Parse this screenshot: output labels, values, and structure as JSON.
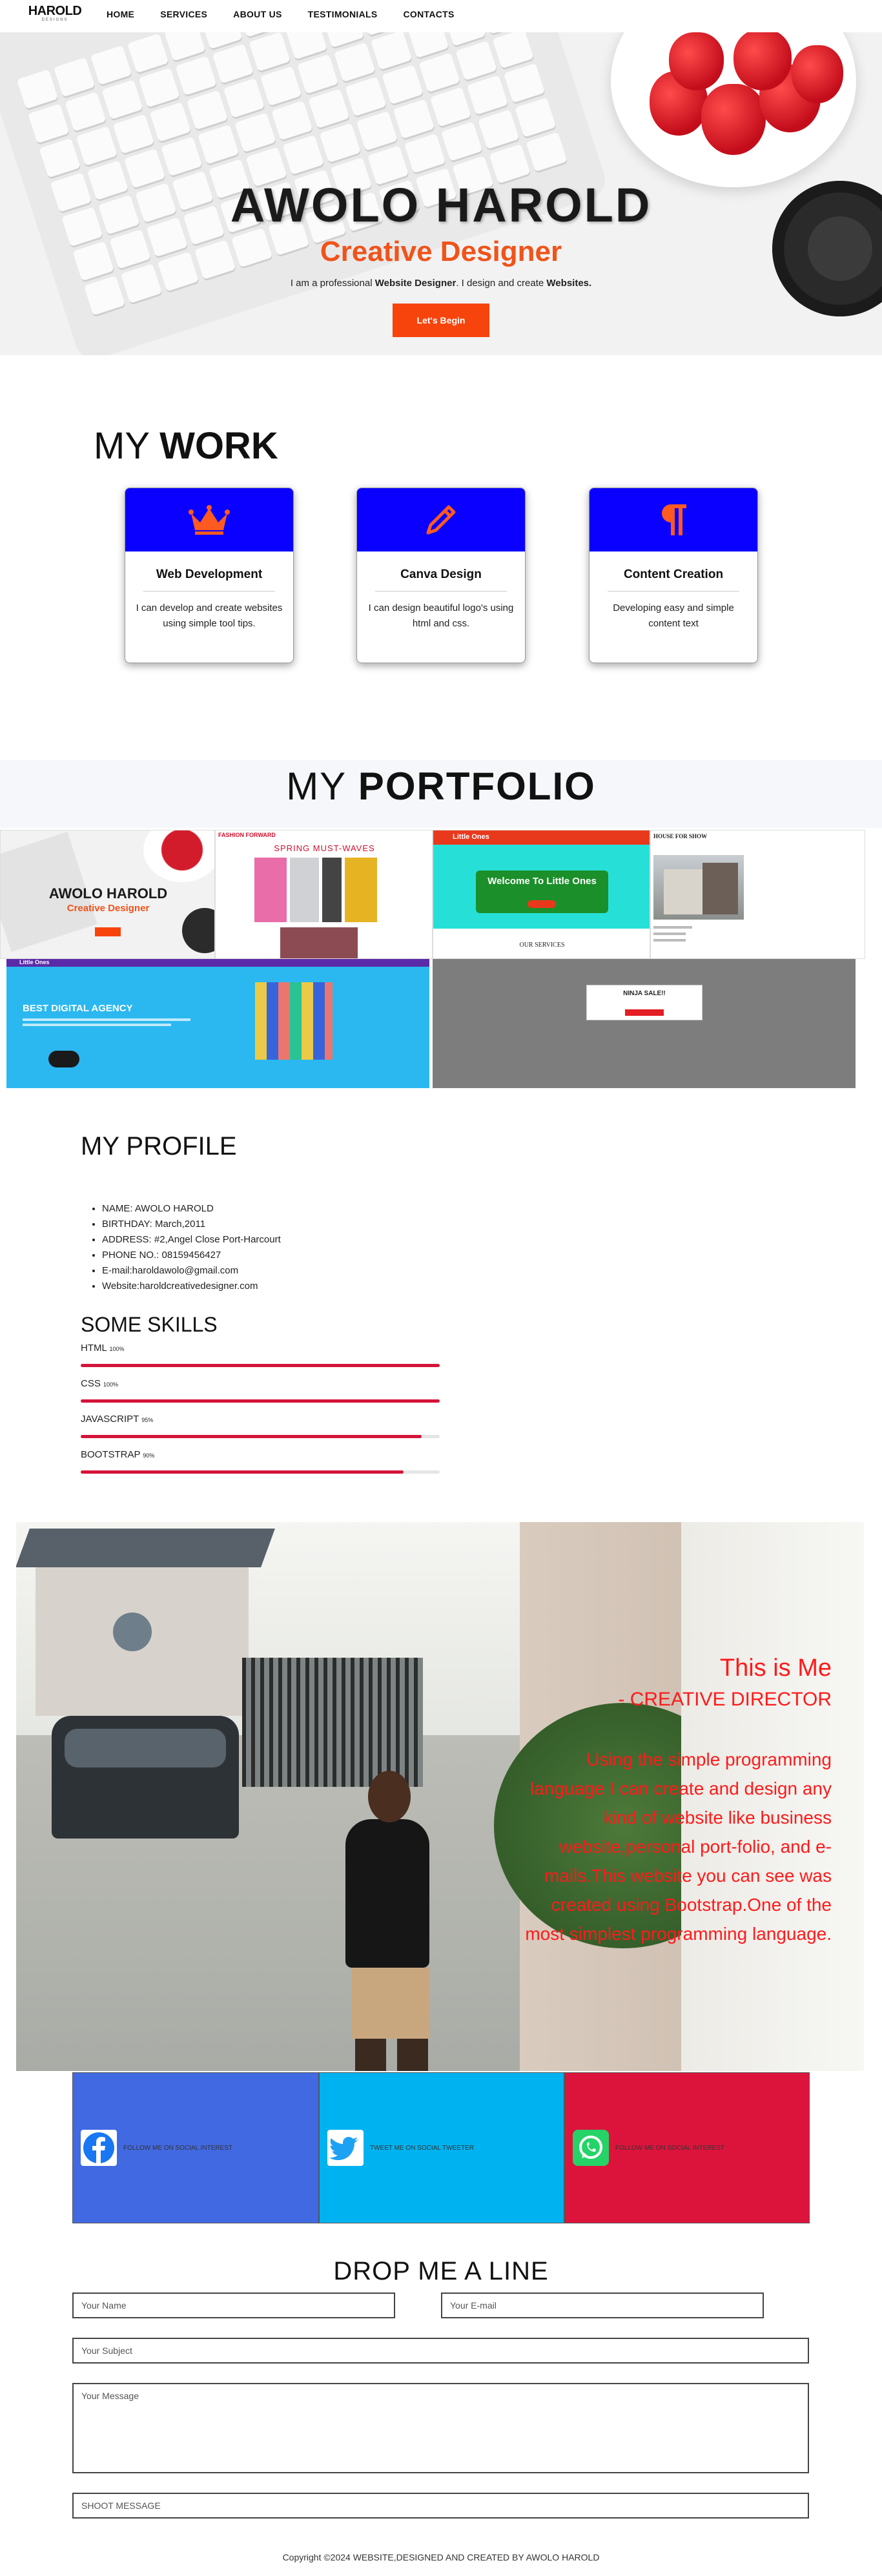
{
  "nav": {
    "logo": "HAROLD",
    "logo_sub": "DESIGNS",
    "links": [
      "HOME",
      "SERVICES",
      "ABOUT US",
      "TESTIMONIALS",
      "CONTACTS"
    ]
  },
  "hero": {
    "title": "AWOLO HAROLD",
    "subtitle": "Creative Designer",
    "desc_pre": "I am a professional ",
    "desc_b1": "Website Designer",
    "desc_mid": ". I design and create ",
    "desc_b2": "Websites.",
    "button": "Let's Begin"
  },
  "work": {
    "title_light": "MY ",
    "title_bold": "WORK",
    "cards": [
      {
        "icon": "crown-icon",
        "title": "Web Development",
        "text": "I can develop and create websites using simple tool tips."
      },
      {
        "icon": "pencil-icon",
        "title": "Canva Design",
        "text": "I can design beautiful logo's using html and css."
      },
      {
        "icon": "pilcrow-icon",
        "title": "Content Creation",
        "text": "Developing easy and simple content text"
      }
    ]
  },
  "portfolio": {
    "title_light": "MY ",
    "title_bold": "PORTFOLIO",
    "thumb_texts": {
      "t1_title": "AWOLO HAROLD",
      "t1_sub": "Creative Designer",
      "t2_brand": "FASHION FORWARD",
      "t2_title": "SPRING MUST-WAVES",
      "t3_brand": "Little Ones",
      "t3_title": "Welcome To Little Ones",
      "t3_foot": "OUR SERVICES",
      "t4_title": "HOUSE FOR SHOW",
      "t5_brand": "Little Ones",
      "t5_title": "BEST DIGITAL AGENCY",
      "t6_title": "NINJA SALE!!"
    }
  },
  "profile": {
    "title": "MY PROFILE",
    "items": [
      "NAME: AWOLO HAROLD",
      "BIRTHDAY: March,2011",
      "ADDRESS: #2,Angel Close Port-Harcourt",
      "PHONE NO.: 08159456427",
      "E-mail:haroldawolo@gmail.com",
      "Website:haroldcreativedesigner.com"
    ],
    "skills_title": "SOME SKILLS",
    "skills": [
      {
        "name": "HTML",
        "pct_label": "100%",
        "pct": 100
      },
      {
        "name": "CSS",
        "pct_label": "100%",
        "pct": 100
      },
      {
        "name": "JAVASCRIPT",
        "pct_label": "95%",
        "pct": 95
      },
      {
        "name": "BOOTSTRAP",
        "pct_label": "90%",
        "pct": 90
      }
    ]
  },
  "about": {
    "title": "This is Me",
    "role": "- CREATIVE DIRECTOR",
    "body": "Using the simple programming language I can create and design any kind of website like business website,personal port-folio, and e-mails.This website you can see was created using Bootstrap.One of the most simplest programming language."
  },
  "social": [
    {
      "label": "FOLLOW ME ON SOCIAL INTEREST",
      "icon": "facebook-icon",
      "color": "#4169e1"
    },
    {
      "label": "TWEET ME ON SOCIAL TWEETER",
      "icon": "twitter-icon",
      "color": "#00b2ef"
    },
    {
      "label": "FOLLOW ME ON SOCIAL INTEREST",
      "icon": "whatsapp-icon",
      "color": "#dc143c"
    }
  ],
  "contact": {
    "title": "DROP ME A LINE",
    "name_ph": "Your Name",
    "email_ph": "Your E-mail",
    "subject_ph": "Your Subject",
    "message_ph": "Your Message",
    "submit": "SHOOT MESSAGE"
  },
  "footer": "Copyright ©2024 WEBSITE,DESIGNED AND CREATED BY AWOLO HAROLD"
}
